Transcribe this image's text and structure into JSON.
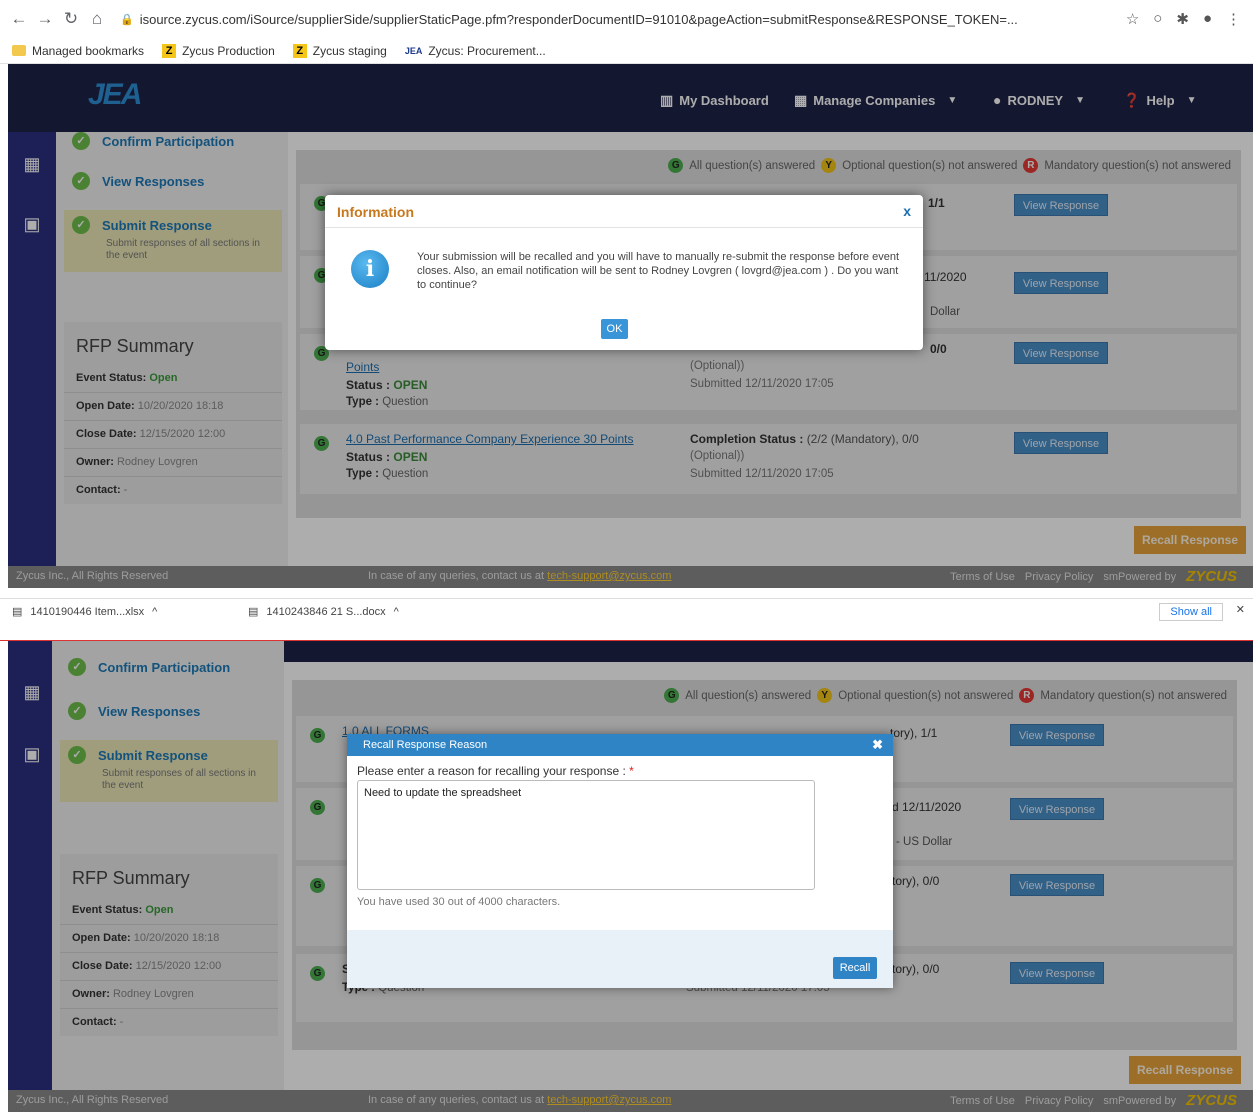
{
  "browser": {
    "url": "isource.zycus.com/iSource/supplierSide/supplierStaticPage.pfm?responderDocumentID=91010&pageAction=submitResponse&RESPONSE_TOKEN=...",
    "bookmarks": [
      "Managed bookmarks",
      "Zycus Production",
      "Zycus staging",
      "Zycus: Procurement..."
    ],
    "downloads": [
      "1410190446 Item...xlsx",
      "1410243846 21 S...docx"
    ],
    "show_all": "Show all"
  },
  "header": {
    "logo": "JEA",
    "dashboard": "My Dashboard",
    "companies": "Manage Companies",
    "user": "RODNEY",
    "help": "Help"
  },
  "steps": {
    "confirm": "Confirm Participation",
    "view": "View Responses",
    "submit": "Submit Response",
    "submit_sub": "Submit responses of all sections in the event"
  },
  "summary": {
    "title": "RFP Summary",
    "status_label": "Event Status:",
    "status_value": "Open",
    "open_label": "Open Date:",
    "open_value": "10/20/2020 18:18",
    "close_label": "Close Date:",
    "close_value": "12/15/2020 12:00",
    "owner_label": "Owner:",
    "owner_value": "Rodney Lovgren",
    "contact_label": "Contact:",
    "contact_value": "-"
  },
  "legend": {
    "all": "All question(s) answered",
    "optional": "Optional question(s) not answered",
    "mandatory": "Mandatory question(s) not answered"
  },
  "rows": {
    "r1_title": "1.0 ALL FORMS",
    "r1_comp_tail": "1/1",
    "r2_date_tail": "11/2020",
    "r2_currency_tail": "Dollar",
    "r2_currency_tail_b": "- US Dollar",
    "r2_date_tail_b": "d 12/11/2020",
    "r3_title": "Points",
    "r3_status_label": "Status :",
    "r3_status": "OPEN",
    "r3_type_label": "Type :",
    "r3_type": "Question",
    "r3_comp_tail": "0/0",
    "r3_optional": "(Optional))",
    "r3_submitted": "Submitted 12/11/2020 17:05",
    "r4_title": "4.0 Past Performance Company Experience 30 Points",
    "r4_status_label": "Status :",
    "r4_status": "OPEN",
    "r4_type_label": "Type :",
    "r4_type": "Question",
    "r4_comp_label": "Completion Status :",
    "r4_comp_value": "(2/2 (Mandatory), 0/0",
    "r4_optional": "(Optional))",
    "r4_submitted": "Submitted 12/11/2020 17:05",
    "mandatory_tail_1": "tory), 1/1",
    "mandatory_tail_2": "tory), 0/0",
    "view_label": "View Response"
  },
  "recall_response": "Recall Response",
  "footer": {
    "left": "Zycus Inc., All Rights Reserved",
    "center": "In case of any queries, contact us at",
    "email": "tech-support@zycus.com",
    "terms": "Terms of Use",
    "privacy": "Privacy Policy",
    "powered": "smPowered by",
    "brand": "ZYCUS"
  },
  "info_dialog": {
    "title": "Information",
    "close": "x",
    "message": "Your submission will be recalled and you will have to manually re-submit the response before event closes. Also, an email notification will be sent to Rodney Lovgren ( lovgrd@jea.com ) . Do you want to continue?",
    "ok": "OK"
  },
  "recall_dialog": {
    "title": "Recall Response Reason",
    "close": "✖",
    "label": "Please enter a reason for recalling your response :",
    "required": "*",
    "value": "Need to update the spreadsheet",
    "counter": "You have used 30 out of 4000 characters.",
    "button": "Recall"
  }
}
